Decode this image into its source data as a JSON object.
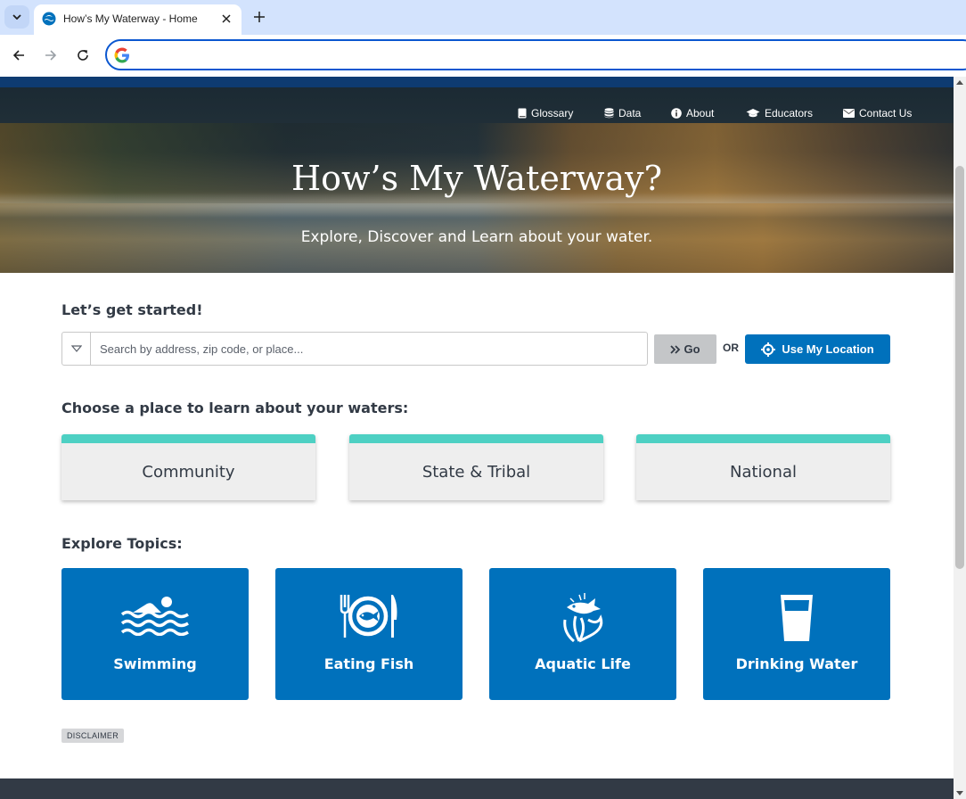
{
  "browser": {
    "tab": {
      "title": "How’s My Waterway - Home"
    },
    "omnibox": {
      "value": ""
    }
  },
  "site": {
    "nav": [
      {
        "label": "Glossary",
        "icon": "book-icon"
      },
      {
        "label": "Data",
        "icon": "database-icon"
      },
      {
        "label": "About",
        "icon": "info-icon"
      },
      {
        "label": "Educators",
        "icon": "graduation-cap-icon"
      },
      {
        "label": "Contact Us",
        "icon": "envelope-icon"
      }
    ],
    "hero": {
      "title": "How’s My Waterway?",
      "subtitle": "Explore, Discover and Learn about your water."
    },
    "search": {
      "heading": "Let’s get started!",
      "placeholder": "Search by address, zip code, or place...",
      "go_label": "Go",
      "or_label": "OR",
      "location_label": "Use My Location"
    },
    "places": {
      "heading": "Choose a place to learn about your waters:",
      "items": [
        "Community",
        "State & Tribal",
        "National"
      ]
    },
    "topics": {
      "heading": "Explore Topics:",
      "items": [
        {
          "label": "Swimming",
          "icon": "swimmer-icon"
        },
        {
          "label": "Eating Fish",
          "icon": "fish-plate-icon"
        },
        {
          "label": "Aquatic Life",
          "icon": "aquatic-life-icon"
        },
        {
          "label": "Drinking Water",
          "icon": "water-glass-icon"
        }
      ]
    },
    "disclaimer": "DISCLAIMER"
  },
  "colors": {
    "brand_blue": "#0071bc",
    "topband": "#0e3b71",
    "accent_teal": "#4dd0c3",
    "footer": "#323a45"
  }
}
